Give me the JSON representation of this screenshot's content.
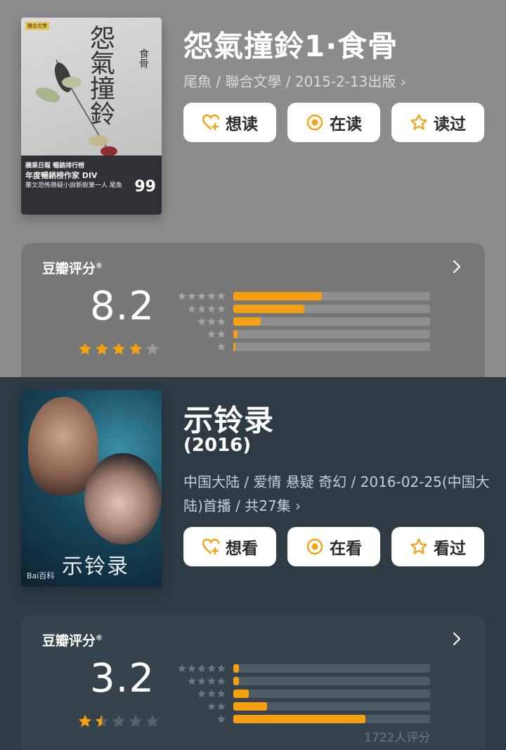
{
  "book": {
    "title": "怨氣撞鈴1·食骨",
    "meta": "尾魚 / 聯合文學 / 2015-2-13出版 ›",
    "cover": {
      "title": "怨氣撞鈴",
      "subtitle": "食骨",
      "band1": "蘋果日報 暢銷排行榜",
      "band2": "年度暢銷榜作家 DIV",
      "band3": "華文恐怖懸疑小說新銳第一人 尾魚",
      "price": "99",
      "tag": "聯合文學"
    },
    "buttons": [
      "想读",
      "在读",
      "读过"
    ],
    "rating": {
      "label": "豆瓣评分",
      "score": "8.2",
      "stars_filled": 4,
      "stars_half": 0,
      "distribution": [
        0.45,
        0.36,
        0.14,
        0.02,
        0.01
      ]
    }
  },
  "drama": {
    "title": "示铃录",
    "year": "(2016)",
    "meta": "中国大陆 / 爱情 悬疑 奇幻 / 2016-02-25(中国大陆)首播 / 共27集 ›",
    "cover": {
      "title": "示铃录",
      "watermark": "Bai百科"
    },
    "buttons": [
      "想看",
      "在看",
      "看过"
    ],
    "rating": {
      "label": "豆瓣评分",
      "score": "3.2",
      "stars_filled": 1,
      "stars_half": 1,
      "distribution": [
        0.03,
        0.03,
        0.08,
        0.17,
        0.67
      ],
      "count": "1722人评分"
    }
  },
  "colors": {
    "accent": "#f5a011",
    "book_bg": "#8c8c8c",
    "drama_bg": "#2e3b45"
  }
}
